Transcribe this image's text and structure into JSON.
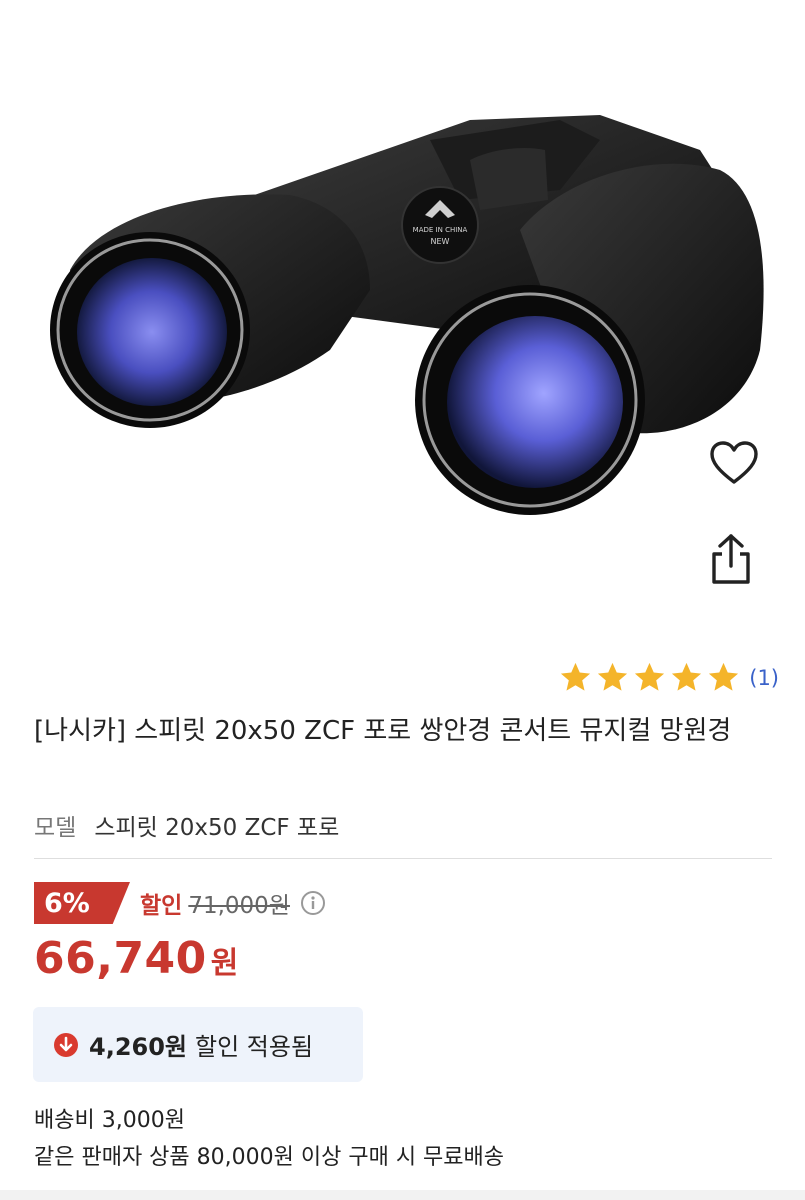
{
  "product": {
    "title": "[나시카] 스피릿 20x50 ZCF 포로 쌍안경 콘서트 뮤지컬 망원경",
    "model_label": "모델",
    "model_value": "스피릿 20x50 ZCF 포로",
    "image_badge_line1": "MADE IN CHINA",
    "image_badge_line2": "NEW"
  },
  "rating": {
    "stars": 5,
    "count_text": "(1)"
  },
  "actions": {
    "wish_icon": "heart-outline-icon",
    "share_icon": "share-icon"
  },
  "pricing": {
    "discount_badge": "6%",
    "discount_label": "할인",
    "original_price": "71,000원",
    "sale_price_number": "66,740",
    "sale_price_unit": "원",
    "applied_amount": "4,260원",
    "applied_text": "할인 적용됨"
  },
  "shipping": {
    "fee": "배송비 3,000원",
    "free_condition": "같은 판매자 상품 80,000원 이상 구매 시 무료배송"
  },
  "colors": {
    "accent_red": "#c8382f",
    "star_yellow": "#f4b42a",
    "link_blue": "#3a62c9",
    "applied_bg": "#eef3fb"
  }
}
